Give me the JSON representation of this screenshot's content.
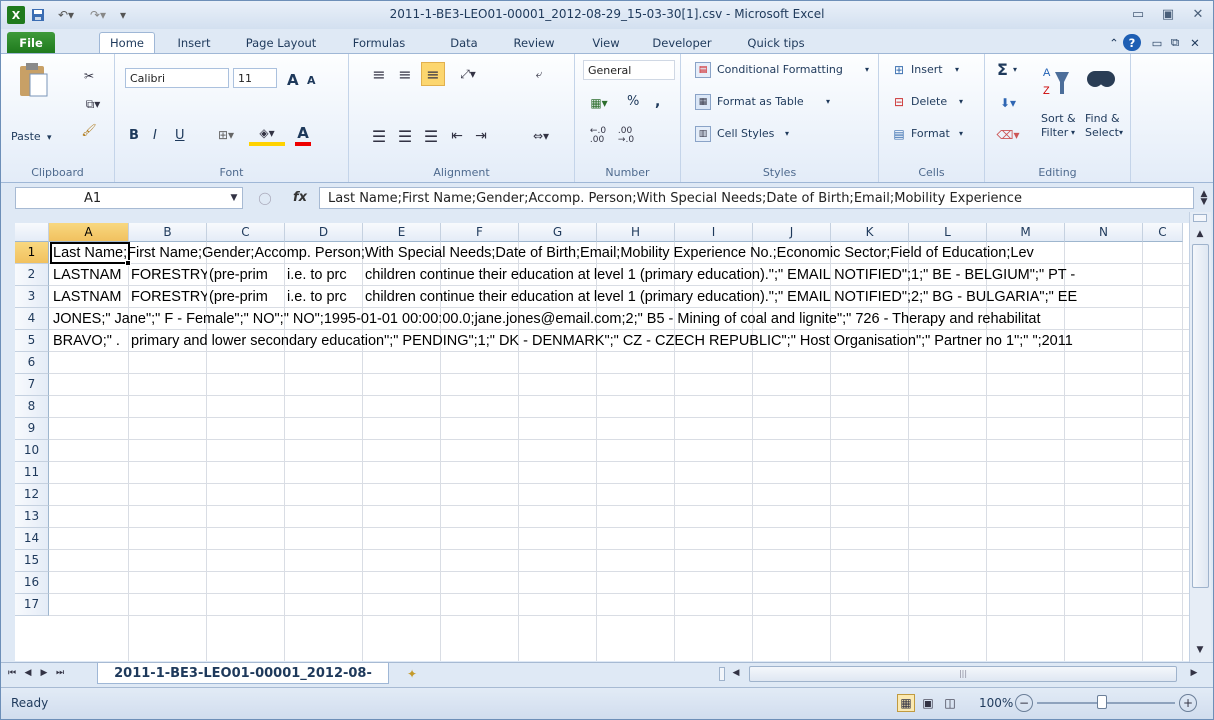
{
  "window": {
    "title": "2011-1-BE3-LEO01-00001_2012-08-29_15-03-30[1].csv  -  Microsoft Excel"
  },
  "tabs": [
    "File",
    "Home",
    "Insert",
    "Page Layout",
    "Formulas",
    "Data",
    "Review",
    "View",
    "Developer",
    "Quick tips"
  ],
  "ribbon": {
    "clipboard": {
      "label": "Clipboard",
      "paste": "Paste"
    },
    "font": {
      "label": "Font",
      "name": "Calibri",
      "size": "11",
      "bold": "B",
      "italic": "I",
      "underline": "U",
      "grow": "A",
      "shrink": "A",
      "color_letter": "A"
    },
    "alignment": {
      "label": "Alignment"
    },
    "number": {
      "label": "Number",
      "format": "General",
      "percent": "%",
      "comma": ",",
      "inc": "+.0\n.00",
      "dec": ".00\n+.0"
    },
    "styles": {
      "label": "Styles",
      "conditional": "Conditional Formatting",
      "table": "Format as Table",
      "cell": "Cell Styles"
    },
    "cells": {
      "label": "Cells",
      "insert": "Insert",
      "delete": "Delete",
      "format": "Format"
    },
    "editing": {
      "label": "Editing",
      "sort1": "Sort &",
      "sort2": "Filter",
      "find1": "Find &",
      "find2": "Select",
      "sigma": "Σ"
    }
  },
  "formula_bar": {
    "name_box": "A1",
    "fx": "fx",
    "value": "Last Name;First Name;Gender;Accomp. Person;With Special Needs;Date of Birth;Email;Mobility Experience"
  },
  "columns": [
    "A",
    "B",
    "C",
    "D",
    "E",
    "F",
    "G",
    "H",
    "I",
    "J",
    "K",
    "L",
    "M",
    "N",
    "C"
  ],
  "rows": [
    "1",
    "2",
    "3",
    "4",
    "5",
    "6",
    "7",
    "8",
    "9",
    "10",
    "11",
    "12",
    "13",
    "14",
    "15",
    "16",
    "17"
  ],
  "cells": {
    "r1": "Last Name;First Name;Gender;Accomp. Person;With Special Needs;Date of Birth;Email;Mobility Experience No.;Economic Sector;Field of Education;Lev",
    "r2": {
      "a": "LASTNAM",
      "b": "FORESTRY",
      "c": "(pre-prim",
      "d": "i.e. to prc",
      "rest": "children continue their education at level 1 (primary education).\";\" EMAIL NOTIFIED\";1;\" BE - BELGIUM\";\" PT -"
    },
    "r3": {
      "a": "LASTNAM",
      "b": "FORESTRY",
      "c": "(pre-prim",
      "d": "i.e. to prc",
      "rest": "children continue their education at level 1 (primary education).\";\" EMAIL NOTIFIED\";2;\" BG - BULGARIA\";\" EE"
    },
    "r4": "JONES;\" Jane\";\" F - Female\";\" NO\";\" NO\";1995-01-01 00:00:00.0;jane.jones@email.com;2;\" B5 - Mining of coal and lignite\";\" 726 - Therapy and rehabilitat",
    "r5": {
      "a": "BRAVO;\" .",
      "rest": "primary and lower secondary education\";\" PENDING\";1;\" DK - DENMARK\";\" CZ - CZECH REPUBLIC\";\" Host Organisation\";\" Partner no 1\";\" \";2011"
    }
  },
  "sheet_tab": "2011-1-BE3-LEO01-00001_2012-08-",
  "status": {
    "ready": "Ready",
    "zoom": "100%"
  }
}
